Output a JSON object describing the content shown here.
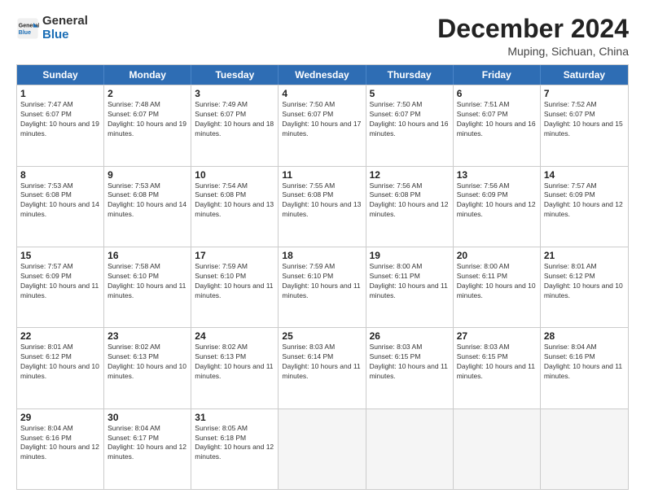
{
  "logo": {
    "line1": "General",
    "line2": "Blue"
  },
  "title": "December 2024",
  "location": "Muping, Sichuan, China",
  "headers": [
    "Sunday",
    "Monday",
    "Tuesday",
    "Wednesday",
    "Thursday",
    "Friday",
    "Saturday"
  ],
  "weeks": [
    [
      {
        "day": "1",
        "rise": "7:47 AM",
        "set": "6:07 PM",
        "hours": "10 hours and 19 minutes"
      },
      {
        "day": "2",
        "rise": "7:48 AM",
        "set": "6:07 PM",
        "hours": "10 hours and 19 minutes"
      },
      {
        "day": "3",
        "rise": "7:49 AM",
        "set": "6:07 PM",
        "hours": "10 hours and 18 minutes"
      },
      {
        "day": "4",
        "rise": "7:50 AM",
        "set": "6:07 PM",
        "hours": "10 hours and 17 minutes"
      },
      {
        "day": "5",
        "rise": "7:50 AM",
        "set": "6:07 PM",
        "hours": "10 hours and 16 minutes"
      },
      {
        "day": "6",
        "rise": "7:51 AM",
        "set": "6:07 PM",
        "hours": "10 hours and 16 minutes"
      },
      {
        "day": "7",
        "rise": "7:52 AM",
        "set": "6:07 PM",
        "hours": "10 hours and 15 minutes"
      }
    ],
    [
      {
        "day": "8",
        "rise": "7:53 AM",
        "set": "6:08 PM",
        "hours": "10 hours and 14 minutes"
      },
      {
        "day": "9",
        "rise": "7:53 AM",
        "set": "6:08 PM",
        "hours": "10 hours and 14 minutes"
      },
      {
        "day": "10",
        "rise": "7:54 AM",
        "set": "6:08 PM",
        "hours": "10 hours and 13 minutes"
      },
      {
        "day": "11",
        "rise": "7:55 AM",
        "set": "6:08 PM",
        "hours": "10 hours and 13 minutes"
      },
      {
        "day": "12",
        "rise": "7:56 AM",
        "set": "6:08 PM",
        "hours": "10 hours and 12 minutes"
      },
      {
        "day": "13",
        "rise": "7:56 AM",
        "set": "6:09 PM",
        "hours": "10 hours and 12 minutes"
      },
      {
        "day": "14",
        "rise": "7:57 AM",
        "set": "6:09 PM",
        "hours": "10 hours and 12 minutes"
      }
    ],
    [
      {
        "day": "15",
        "rise": "7:57 AM",
        "set": "6:09 PM",
        "hours": "10 hours and 11 minutes"
      },
      {
        "day": "16",
        "rise": "7:58 AM",
        "set": "6:10 PM",
        "hours": "10 hours and 11 minutes"
      },
      {
        "day": "17",
        "rise": "7:59 AM",
        "set": "6:10 PM",
        "hours": "10 hours and 11 minutes"
      },
      {
        "day": "18",
        "rise": "7:59 AM",
        "set": "6:10 PM",
        "hours": "10 hours and 11 minutes"
      },
      {
        "day": "19",
        "rise": "8:00 AM",
        "set": "6:11 PM",
        "hours": "10 hours and 11 minutes"
      },
      {
        "day": "20",
        "rise": "8:00 AM",
        "set": "6:11 PM",
        "hours": "10 hours and 10 minutes"
      },
      {
        "day": "21",
        "rise": "8:01 AM",
        "set": "6:12 PM",
        "hours": "10 hours and 10 minutes"
      }
    ],
    [
      {
        "day": "22",
        "rise": "8:01 AM",
        "set": "6:12 PM",
        "hours": "10 hours and 10 minutes"
      },
      {
        "day": "23",
        "rise": "8:02 AM",
        "set": "6:13 PM",
        "hours": "10 hours and 10 minutes"
      },
      {
        "day": "24",
        "rise": "8:02 AM",
        "set": "6:13 PM",
        "hours": "10 hours and 11 minutes"
      },
      {
        "day": "25",
        "rise": "8:03 AM",
        "set": "6:14 PM",
        "hours": "10 hours and 11 minutes"
      },
      {
        "day": "26",
        "rise": "8:03 AM",
        "set": "6:15 PM",
        "hours": "10 hours and 11 minutes"
      },
      {
        "day": "27",
        "rise": "8:03 AM",
        "set": "6:15 PM",
        "hours": "10 hours and 11 minutes"
      },
      {
        "day": "28",
        "rise": "8:04 AM",
        "set": "6:16 PM",
        "hours": "10 hours and 11 minutes"
      }
    ],
    [
      {
        "day": "29",
        "rise": "8:04 AM",
        "set": "6:16 PM",
        "hours": "10 hours and 12 minutes"
      },
      {
        "day": "30",
        "rise": "8:04 AM",
        "set": "6:17 PM",
        "hours": "10 hours and 12 minutes"
      },
      {
        "day": "31",
        "rise": "8:05 AM",
        "set": "6:18 PM",
        "hours": "10 hours and 12 minutes"
      },
      {
        "day": "",
        "rise": "",
        "set": "",
        "hours": ""
      },
      {
        "day": "",
        "rise": "",
        "set": "",
        "hours": ""
      },
      {
        "day": "",
        "rise": "",
        "set": "",
        "hours": ""
      },
      {
        "day": "",
        "rise": "",
        "set": "",
        "hours": ""
      }
    ]
  ]
}
